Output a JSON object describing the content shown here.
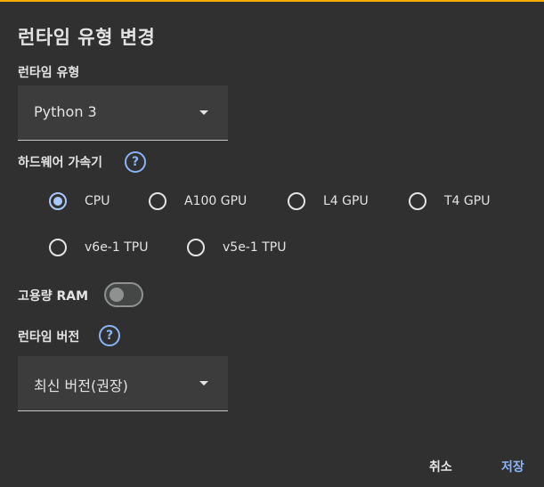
{
  "dialog": {
    "title": "런타임 유형 변경"
  },
  "runtime_type": {
    "label": "런타임 유형",
    "selected": "Python 3"
  },
  "hardware_accelerator": {
    "label": "하드웨어 가속기",
    "help_icon": "?",
    "options": [
      {
        "label": "CPU",
        "checked": true
      },
      {
        "label": "A100 GPU",
        "checked": false
      },
      {
        "label": "L4 GPU",
        "checked": false
      },
      {
        "label": "T4 GPU",
        "checked": false
      },
      {
        "label": "v6e-1 TPU",
        "checked": false
      },
      {
        "label": "v5e-1 TPU",
        "checked": false
      }
    ]
  },
  "high_ram": {
    "label": "고용량 RAM",
    "enabled": false
  },
  "runtime_version": {
    "label": "런타임 버전",
    "help_icon": "?",
    "selected": "최신 버전(권장)"
  },
  "footer": {
    "cancel_label": "취소",
    "save_label": "저장"
  },
  "colors": {
    "background": "#303030",
    "accent": "#a8c7fa",
    "link": "#8ab4f8",
    "top_bar": "#f9ab00"
  }
}
